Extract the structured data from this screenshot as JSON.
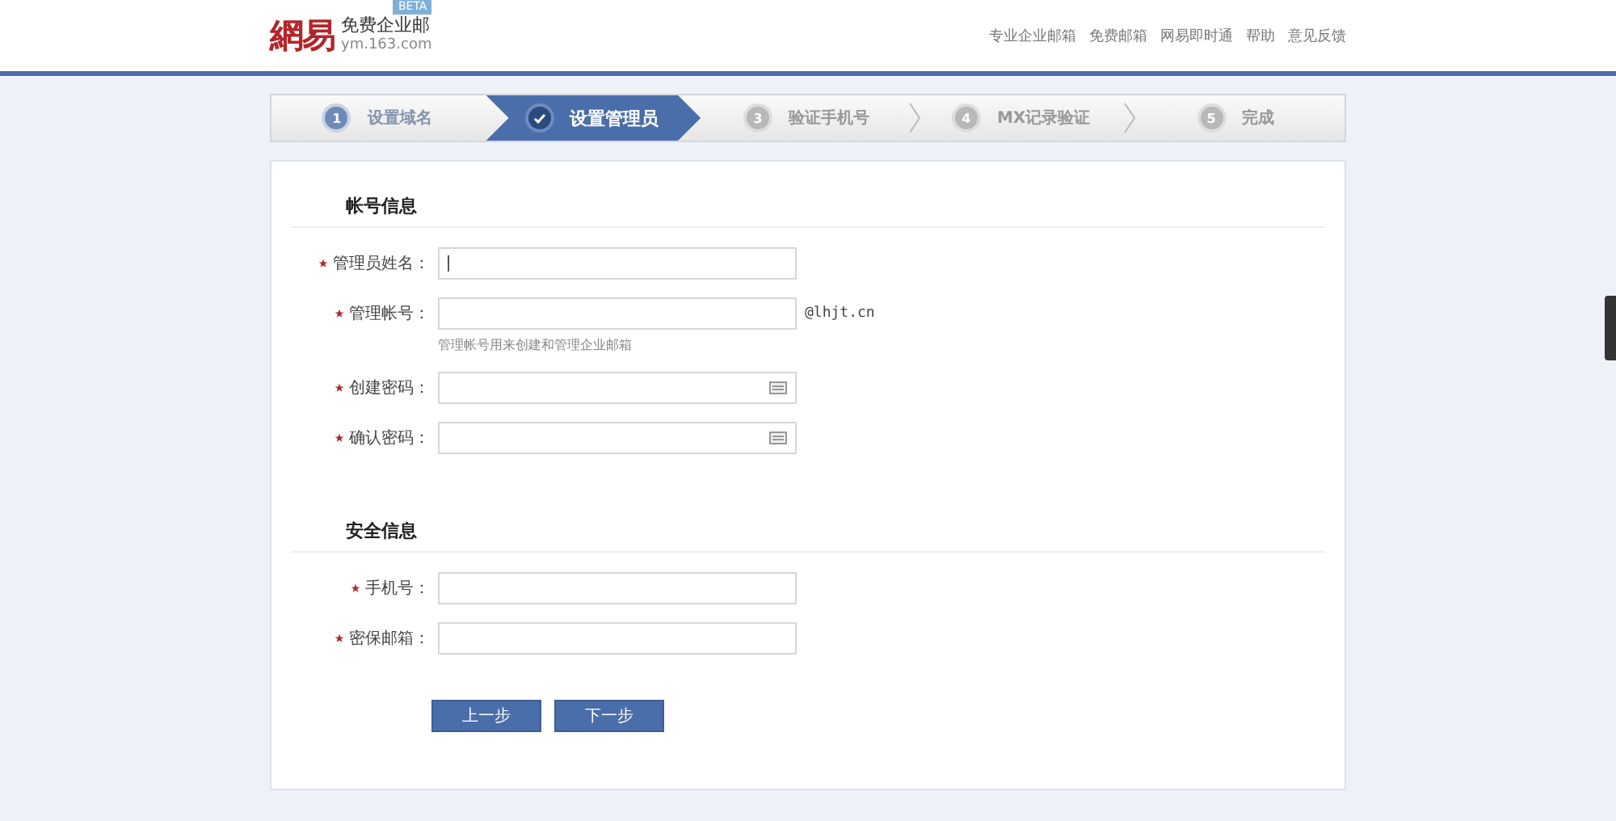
{
  "header": {
    "logo_mark": "網易",
    "logo_title": "免费企业邮",
    "logo_badge": "BETA",
    "logo_domain": "ym.163.com",
    "links": [
      "专业企业邮箱",
      "免费邮箱",
      "网易即时通",
      "帮助",
      "意见反馈"
    ]
  },
  "steps": [
    {
      "number": "1",
      "label": "设置域名",
      "done": true,
      "selected": false
    },
    {
      "label": "设置管理员",
      "done": false,
      "selected": true
    },
    {
      "number": "3",
      "label": "验证手机号",
      "done": false,
      "selected": false
    },
    {
      "number": "4",
      "label": "MX记录验证",
      "done": false,
      "selected": false
    },
    {
      "number": "5",
      "label": "完成",
      "done": false,
      "selected": false
    }
  ],
  "sections": [
    {
      "title": "帐号信息",
      "fields": [
        {
          "label": "管理员姓名：",
          "required": true,
          "kind": "text",
          "focused": true
        },
        {
          "label": "管理帐号：",
          "required": true,
          "kind": "text",
          "suffix": "@lhjt.cn",
          "hint": "管理帐号用来创建和管理企业邮箱"
        },
        {
          "label": "创建密码：",
          "required": true,
          "kind": "password"
        },
        {
          "label": "确认密码：",
          "required": true,
          "kind": "password"
        }
      ]
    },
    {
      "title": "安全信息",
      "fields": [
        {
          "label": "手机号：",
          "required": true,
          "kind": "text"
        },
        {
          "label": "密保邮箱：",
          "required": true,
          "kind": "text"
        }
      ]
    }
  ],
  "buttons": [
    "上一步",
    "下一步"
  ]
}
